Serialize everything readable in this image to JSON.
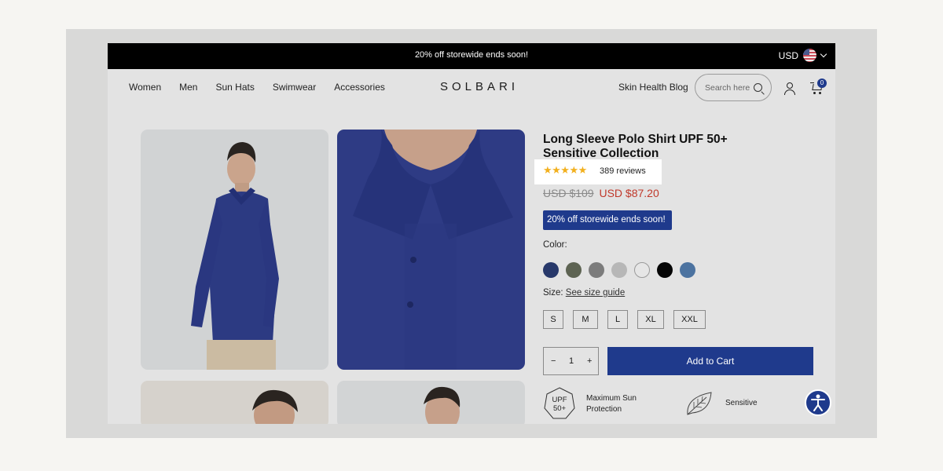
{
  "announcement": "20% off storewide ends soon!",
  "currency": "USD",
  "nav": [
    "Women",
    "Men",
    "Sun Hats",
    "Swimwear",
    "Accessories"
  ],
  "brand": "SOLBARI",
  "blog_link": "Skin Health Blog",
  "search_placeholder": "Search here",
  "cart_count": "0",
  "product": {
    "title": "Long Sleeve Polo Shirt UPF 50+ Sensitive Collection",
    "stars": "★★★★★",
    "rating_fraction": 1.0,
    "reviews": "389 reviews",
    "old_price": "USD $109",
    "new_price": "USD $87.20",
    "promo": "20% off storewide ends soon!",
    "color_label": "Color:",
    "colors": [
      "#27386a",
      "#5d6352",
      "#7c7c7c",
      "#b7b7b7",
      "#e6e6e6",
      "#050505",
      "#4c73a0"
    ],
    "size_label": "Size:",
    "size_guide": "See size guide",
    "sizes": [
      "S",
      "M",
      "L",
      "XL",
      "XXL"
    ],
    "quantity": "1",
    "qty_minus": "−",
    "qty_plus": "+",
    "add_to_cart": "Add to Cart",
    "features": [
      {
        "badge": "UPF\n50+",
        "label": "Maximum Sun\nProtection"
      },
      {
        "label": "Sensitive"
      }
    ]
  },
  "colors": {
    "accent": "#1f3a8c",
    "sale": "#c0392b",
    "stars": "#f2b01e"
  }
}
